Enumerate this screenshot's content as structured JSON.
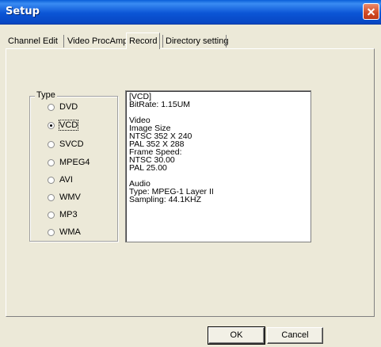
{
  "window": {
    "title": "Setup"
  },
  "tabs": [
    {
      "label": "Channel Edit",
      "active": false
    },
    {
      "label": "Video ProcAmp",
      "active": false
    },
    {
      "label": "Record",
      "active": true
    },
    {
      "label": "Directory setting",
      "active": false
    }
  ],
  "type_group": {
    "legend": "Type",
    "selected": "VCD",
    "options": [
      "DVD",
      "VCD",
      "SVCD",
      "MPEG4",
      "AVI",
      "WMV",
      "MP3",
      "WMA"
    ]
  },
  "info": {
    "lines": [
      "[VCD]",
      "BitRate: 1.15UM",
      "",
      "Video",
      "Image Size",
      "NTSC 352 X 240",
      "PAL  352 X 288",
      "Frame Speed:",
      "NTSC  30.00",
      "PAL   25.00",
      "",
      "Audio",
      "Type: MPEG-1 Layer II",
      "Sampling: 44.1KHZ"
    ]
  },
  "buttons": {
    "ok": "OK",
    "cancel": "Cancel"
  },
  "colors": {
    "titlebar": "#0b55d6",
    "close": "#d14a24",
    "face": "#ece9d8"
  }
}
